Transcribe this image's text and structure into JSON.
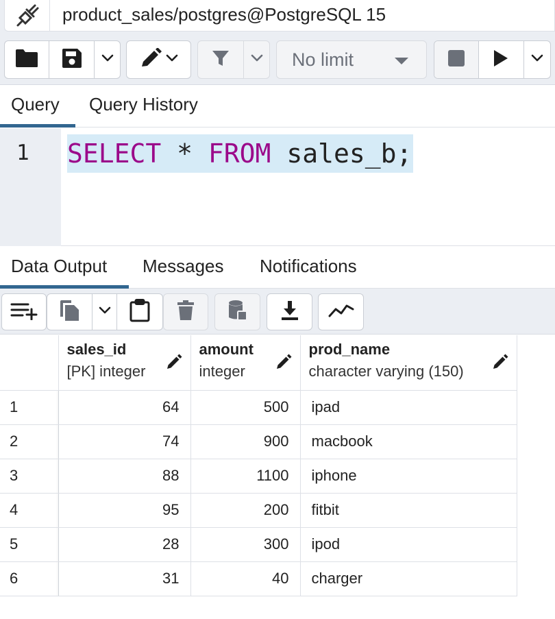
{
  "connection": {
    "title": "product_sales/postgres@PostgreSQL 15",
    "icon": "disconnected-plug-icon"
  },
  "toolbar": {
    "open_icon": "folder-icon",
    "save_icon": "floppy-disk-icon",
    "edit_icon": "pencil-icon",
    "filter_icon": "filter-icon",
    "limit_value": "No limit",
    "stop_icon": "stop-square-icon",
    "execute_icon": "play-icon"
  },
  "editor_tabs": [
    "Query",
    "Query History"
  ],
  "editor": {
    "line_number": "1",
    "tokens": {
      "kw1": "SELECT",
      "star": " * ",
      "kw2": "FROM",
      "rest": " sales_b;"
    }
  },
  "output_tabs": [
    "Data Output",
    "Messages",
    "Notifications"
  ],
  "grid_toolbar": {
    "icons": [
      "add-row-icon",
      "copy-icon",
      "paste-icon",
      "delete-icon",
      "save-data-icon",
      "download-icon",
      "graph-visualiser-icon"
    ]
  },
  "table": {
    "columns": [
      {
        "name": "sales_id",
        "type": "[PK] integer"
      },
      {
        "name": "amount",
        "type": "integer"
      },
      {
        "name": "prod_name",
        "type": "character varying (150)"
      }
    ],
    "rows": [
      {
        "n": "1",
        "sales_id": "64",
        "amount": "500",
        "prod_name": "ipad"
      },
      {
        "n": "2",
        "sales_id": "74",
        "amount": "900",
        "prod_name": "macbook"
      },
      {
        "n": "3",
        "sales_id": "88",
        "amount": "1100",
        "prod_name": "iphone"
      },
      {
        "n": "4",
        "sales_id": "95",
        "amount": "200",
        "prod_name": "fitbit"
      },
      {
        "n": "5",
        "sales_id": "28",
        "amount": "300",
        "prod_name": "ipod"
      },
      {
        "n": "6",
        "sales_id": "31",
        "amount": "40",
        "prod_name": "charger"
      }
    ]
  },
  "colors": {
    "accent": "#326690",
    "keyword": "#9b0a8a",
    "selection": "#d6ebf7",
    "toolbar_bg": "#ebeef3"
  }
}
